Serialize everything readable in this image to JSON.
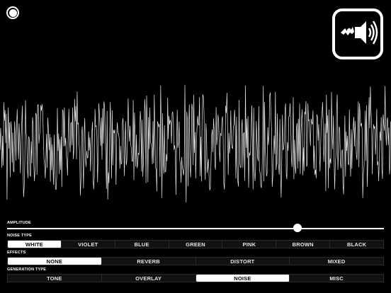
{
  "icons": {
    "record": "record-circle-icon",
    "app": "bat-speaker-icon"
  },
  "amplitude": {
    "label": "AMPLITUDE",
    "value": 0.77
  },
  "noise_type": {
    "label": "NOISE TYPE",
    "options": [
      "WHITE",
      "VIOLET",
      "BLUE",
      "GREEN",
      "PINK",
      "BROWN",
      "BLACK"
    ],
    "selected": "WHITE"
  },
  "effects": {
    "label": "EFFECTS",
    "options": [
      "NONE",
      "REVERB",
      "DISTORT",
      "MIXED"
    ],
    "selected": "NONE"
  },
  "generation_type": {
    "label": "GENERATION TYPE",
    "options": [
      "TONE",
      "OVERLAY",
      "NOISE",
      "MISC"
    ],
    "selected": "NOISE"
  }
}
